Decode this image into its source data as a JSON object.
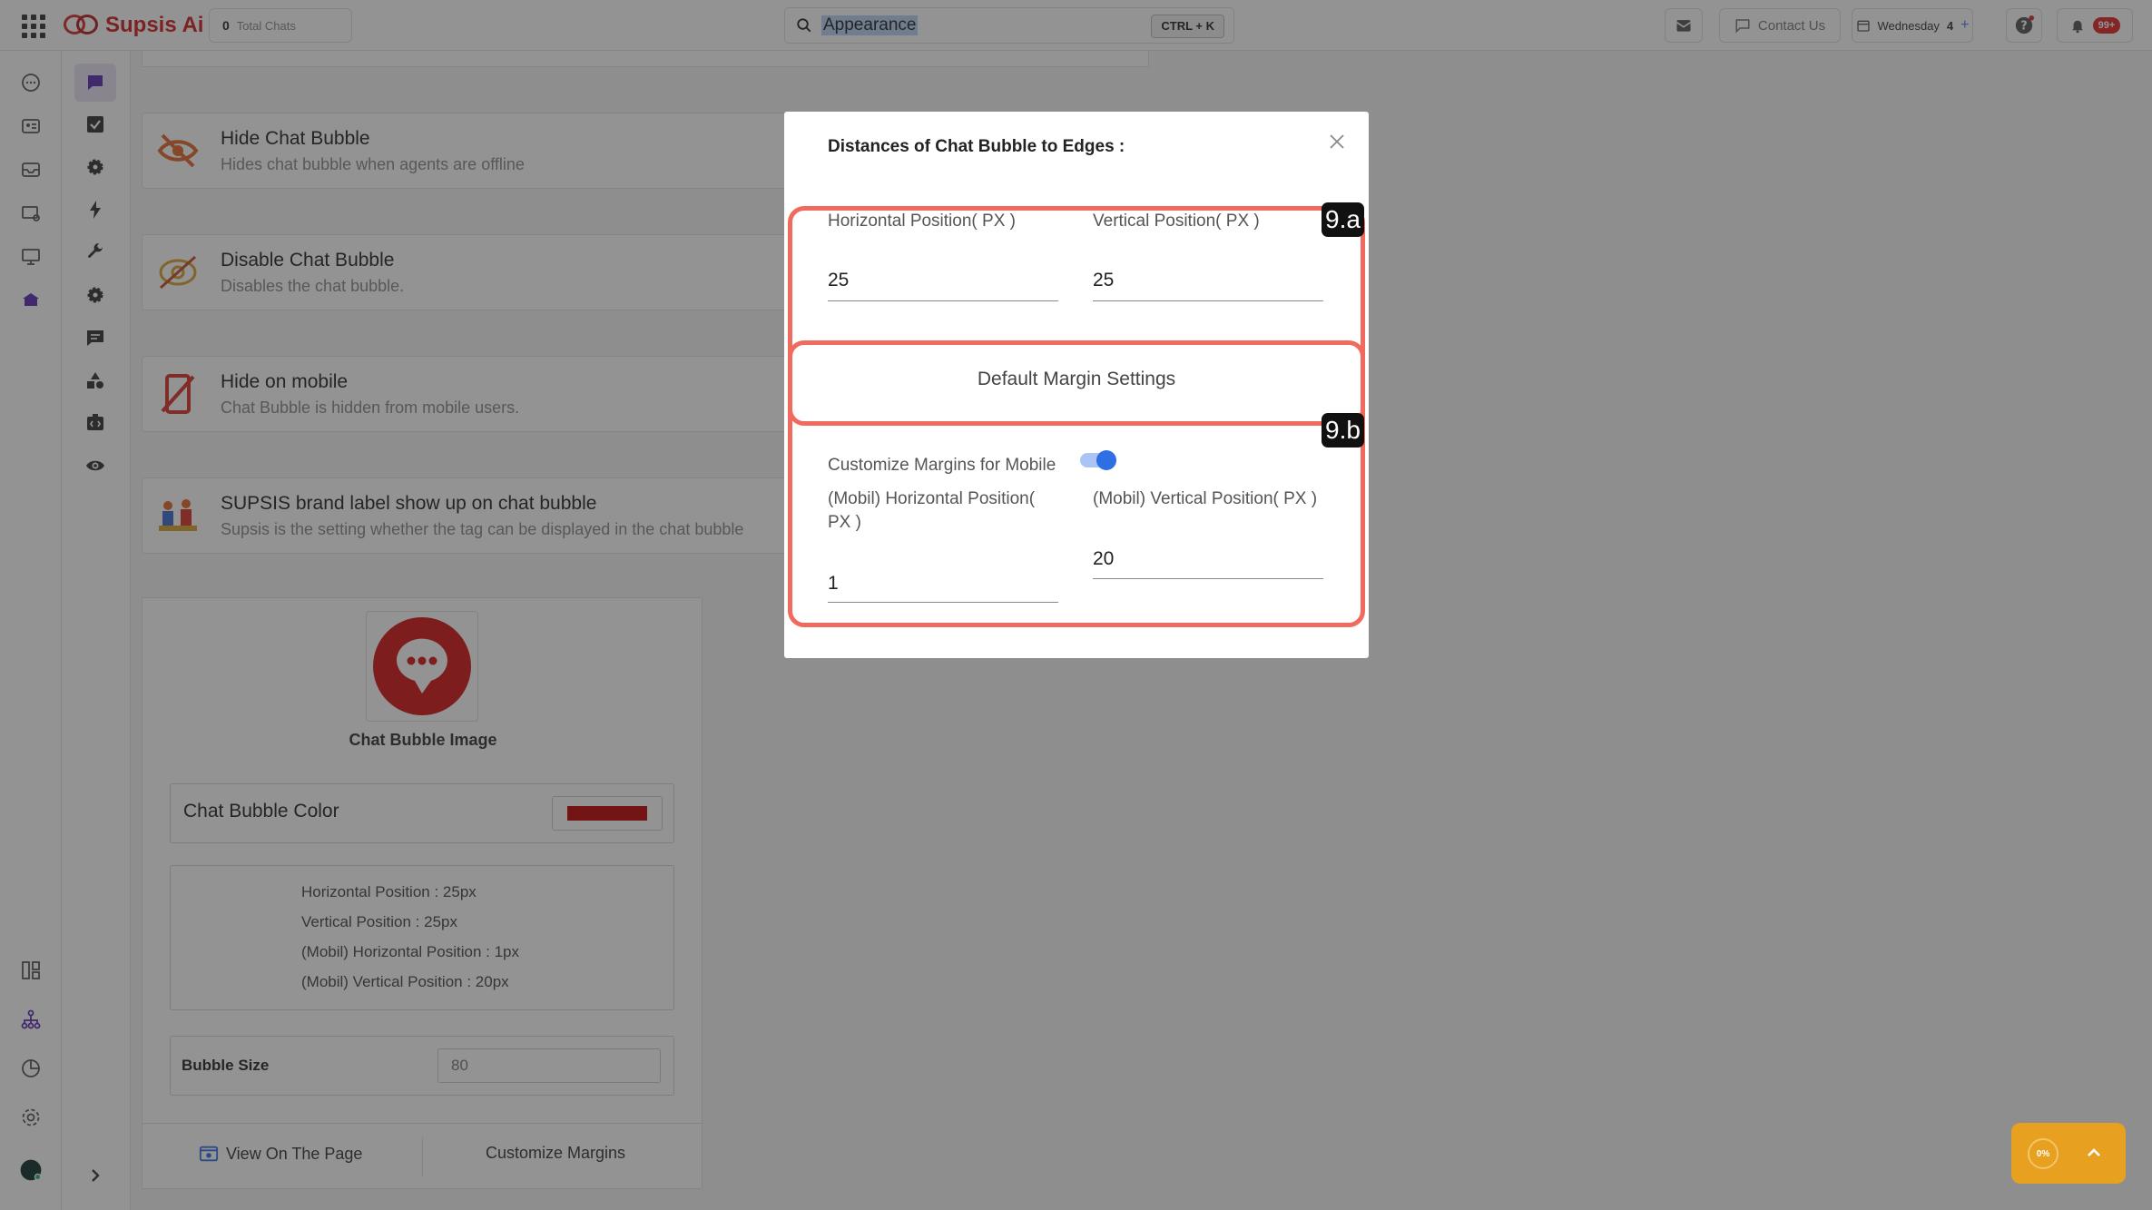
{
  "topbar": {
    "brand": "Supsis Ai",
    "total_chats_count": "0",
    "total_chats_label": "Total Chats",
    "search_value": "Appearance",
    "search_shortcut": "CTRL + K",
    "contact_us": "Contact Us",
    "day": "Wednesday",
    "day_number": "4",
    "notifications_badge": "99+"
  },
  "settings": [
    {
      "title": "Hide Chat Bubble",
      "description": "Hides chat bubble when agents are offline"
    },
    {
      "title": "Disable Chat Bubble",
      "description": "Disables the chat bubble."
    },
    {
      "title": "Hide on mobile",
      "description": "Chat Bubble is hidden from mobile users."
    },
    {
      "title": "SUPSIS brand label show up on chat bubble",
      "description": "Supsis is the setting whether the tag can be displayed in the chat bubble"
    }
  ],
  "bubble_panel": {
    "image_caption": "Chat Bubble Image",
    "color_label": "Chat Bubble Color",
    "color_value": "#c00000",
    "info_lines": [
      "Horizontal Position : 25px",
      "Vertical Position : 25px",
      "(Mobil) Horizontal Position : 1px",
      "(Mobil) Vertical Position : 20px"
    ],
    "size_label": "Bubble Size",
    "size_value": "80",
    "view_button": "View On The Page",
    "customize_button": "Customize Margins"
  },
  "modal": {
    "title": "Distances of Chat Bubble to Edges :",
    "horizontal_label": "Horizontal Position( PX )",
    "horizontal_value": "25",
    "vertical_label": "Vertical Position( PX )",
    "vertical_value": "25",
    "default_margin_label": "Default Margin Settings",
    "mobile_toggle_label": "Customize Margins for Mobile",
    "mobile_toggle_on": true,
    "mobile_horizontal_label_line1": "(Mobil) Horizontal Position(",
    "mobile_horizontal_label_line2": "PX )",
    "mobile_horizontal_value": "1",
    "mobile_vertical_label": "(Mobil) Vertical Position( PX )",
    "mobile_vertical_value": "20"
  },
  "annotations": {
    "tag_a": "9.a",
    "tag_b": "9.b"
  },
  "progress_widget": {
    "percent_label": "0%"
  },
  "colors": {
    "brand_red": "#d01c1c",
    "accent_purple": "#5b2bb5",
    "highlight": "#f06a5e",
    "toggle_blue": "#2f6fe4",
    "widget_orange": "#e8a020"
  }
}
